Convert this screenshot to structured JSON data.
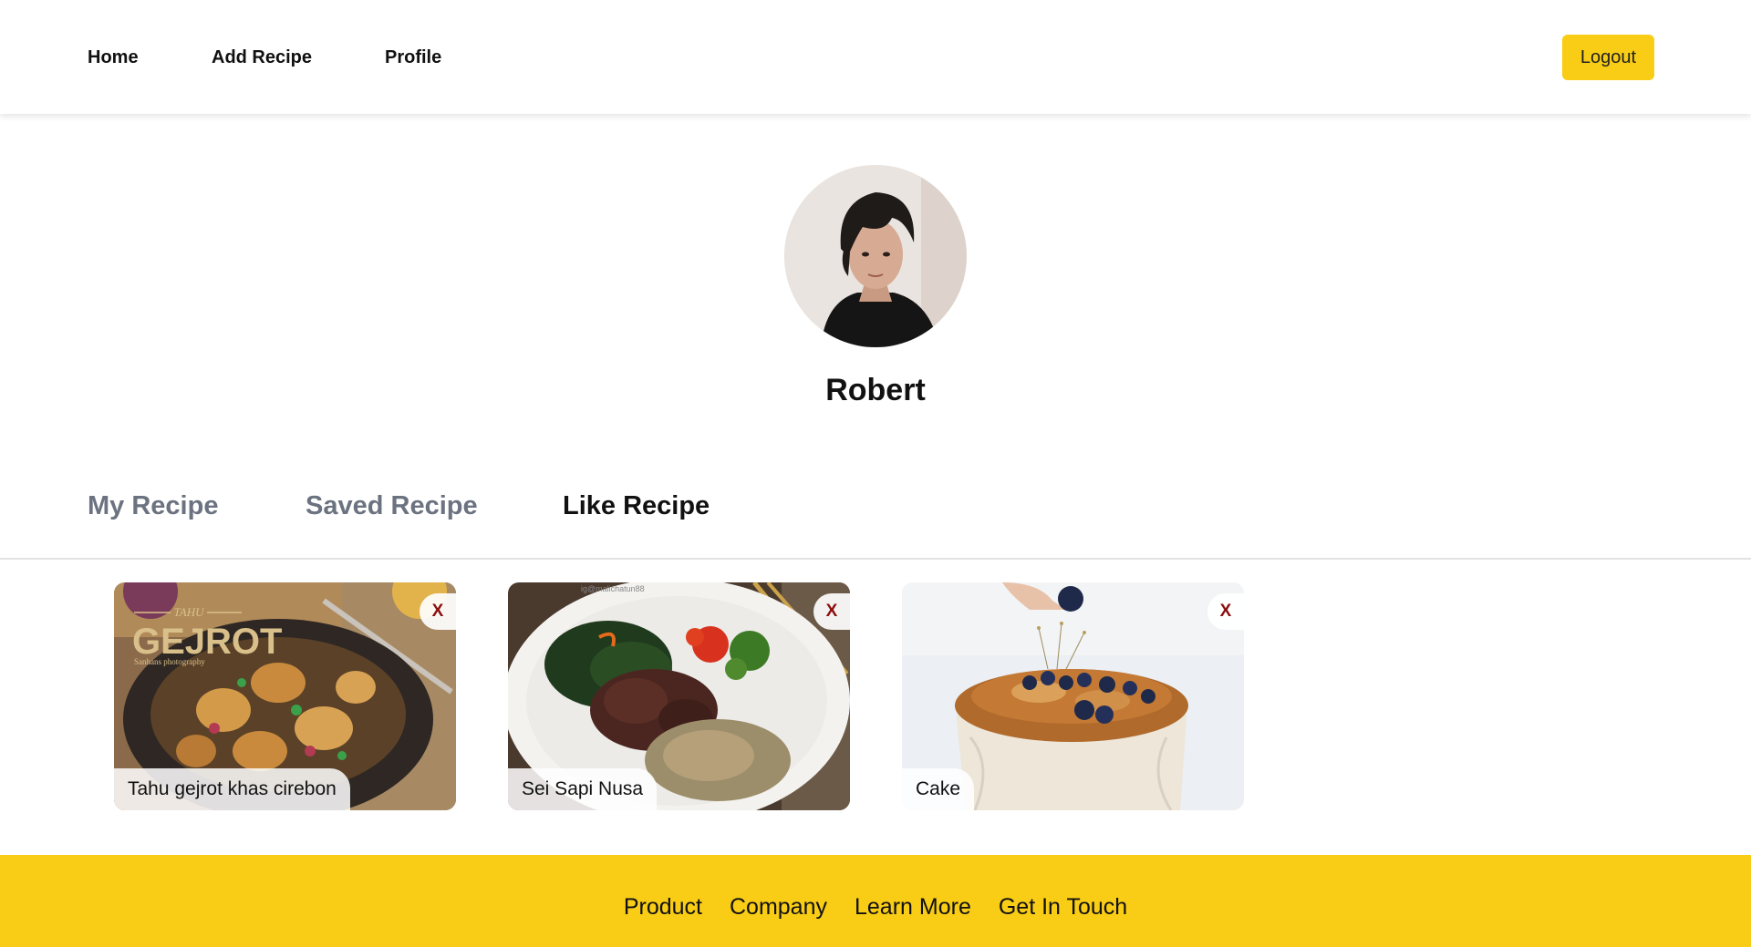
{
  "nav": {
    "home": "Home",
    "add_recipe": "Add Recipe",
    "profile": "Profile",
    "logout": "Logout"
  },
  "profile": {
    "name": "Robert"
  },
  "tabs": [
    {
      "label": "My Recipe",
      "active": false
    },
    {
      "label": "Saved Recipe",
      "active": false
    },
    {
      "label": "Like Recipe",
      "active": true
    }
  ],
  "recipes": [
    {
      "title": "Tahu gejrot khas cirebon",
      "remove_label": "X",
      "photo_text_small": "TAHU",
      "photo_text_big": "GEJROT",
      "photo_text_credit": "Sanhans photography"
    },
    {
      "title": "Sei Sapi Nusa",
      "remove_label": "X",
      "photo_text_small": "ig@malichatun88"
    },
    {
      "title": "Cake",
      "remove_label": "X"
    }
  ],
  "footer": {
    "links": [
      "Product",
      "Company",
      "Learn More",
      "Get In Touch"
    ]
  },
  "colors": {
    "accent": "#f9cc16",
    "tab_inactive": "#6b7280",
    "remove": "#8b0e0e"
  }
}
